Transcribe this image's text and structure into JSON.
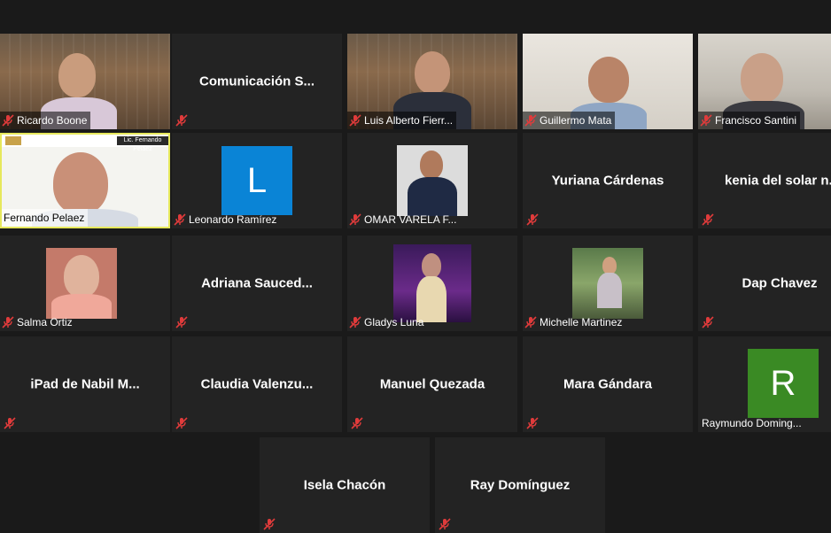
{
  "participants": [
    {
      "name": "Ricardo Boone"
    },
    {
      "name": "Comunicación  S..."
    },
    {
      "name": "Luis Alberto Fierr..."
    },
    {
      "name": "Guillermo Mata"
    },
    {
      "name": "Francisco Santini"
    },
    {
      "name": "Fernando Pelaez"
    },
    {
      "name": "Leonardo Ramírez",
      "avatar_letter": "L",
      "avatar_color": "#0a84d6"
    },
    {
      "name": "OMAR VARELA F..."
    },
    {
      "name": "Yuriana Cárdenas"
    },
    {
      "name": "kenia del solar n..."
    },
    {
      "name": "Salma Ortiz"
    },
    {
      "name": "Adriana  Sauced..."
    },
    {
      "name": "Gladys Luna"
    },
    {
      "name": "Michelle Martinez"
    },
    {
      "name": "Dap Chavez"
    },
    {
      "name": "iPad de Nabil M..."
    },
    {
      "name": "Claudia  Valenzu..."
    },
    {
      "name": "Manuel Quezada"
    },
    {
      "name": "Mara Gándara"
    },
    {
      "name": "Raymundo Doming...",
      "avatar_letter": "R",
      "avatar_color": "#3a8a24"
    },
    {
      "name": "Isela Chacón"
    },
    {
      "name": "Ray Domínguez"
    }
  ],
  "slide_header_text": "Lic. Fernando Pelaez",
  "colors": {
    "background": "#1a1a1a",
    "tile": "#232323",
    "active_speaker_border": "#e6e85c",
    "muted_icon": "#e03b3b"
  },
  "icons": {
    "muted": "mic-muted-icon"
  }
}
